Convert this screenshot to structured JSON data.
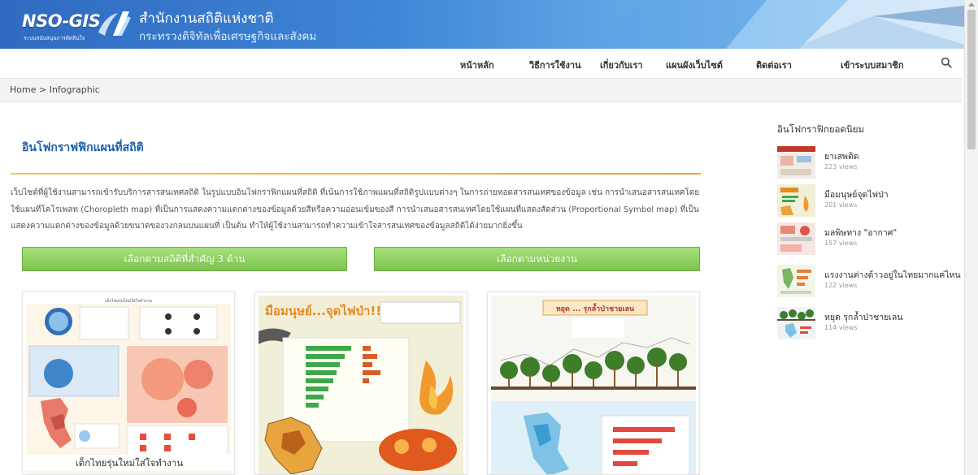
{
  "header": {
    "logo_text": "NSO-GIS",
    "logo_subtext": "ระบบสนับสนุนการตัดสินใจ",
    "site_name": "สำนักงานสถิติแห่งชาติ",
    "site_subtitle": "กระทรวงดิจิทัลเพื่อเศรษฐกิจและสังคม"
  },
  "nav": {
    "items": [
      {
        "label": "หน้าหลัก"
      },
      {
        "label": "วิธีการใช้งาน"
      },
      {
        "label": "เกี่ยวกับเรา"
      },
      {
        "label": "แผนผังเว็บไซต์"
      },
      {
        "label": "ติดต่อเรา"
      },
      {
        "label": "เข้าระบบสมาชิก"
      }
    ],
    "search_icon": "search-icon"
  },
  "breadcrumb": {
    "home": "Home",
    "separator": ">",
    "current": "Infographic"
  },
  "main": {
    "title": "อินโฟกราฟฟิกแผนที่สถิติ",
    "description": "เว็บไซต์ที่ผู้ใช้งานสามารถเข้ารับบริการสารสนเทศสถิติ ในรูปแบบอินโฟกราฟิกแผนที่สถิติ ที่เน้นการใช้ภาพแผนที่สถิติรูปแบบต่างๆ ในการถ่ายทอดสารสนเทศของข้อมูล เช่น การนำเสนอสารสนเทศโดยใช้แผนที่โคโรเพลท (Choropleth map) ที่เป็นการแสดงความแตกต่างของข้อมูลด้วยสีหรือความอ่อนเข้มของสี การนำเสนอสารสนเทศโดยใช้แผนที่แสดงสัดส่วน (Proportional Symbol map) ที่เป็นแสดงความแตกต่างของข้อมูลด้วยขนาดของวงกลมบนแผนที่ เป็นต้น ทำให้ผู้ใช้งานสามารถทำความเข้าใจสารสนเทศของข้อมูลสถิติได้ง่ายมากยิ่งขึ้น",
    "buttons": [
      {
        "label": "เลือกตามสถิติที่สำคัญ 3 ด้าน"
      },
      {
        "label": "เลือกตามหน่วยงาน"
      }
    ],
    "cards": [
      {
        "caption": "เด็กไทยรุ่นใหม่ใส่ใจทำงาน",
        "heading": "เด็กไทยรุ่นใหม่ใส่ใจทำงาน"
      },
      {
        "caption": "",
        "heading": "มือมนุษย์...จุดไฟป่า!!!"
      },
      {
        "caption": "",
        "heading": "หยุด ... รุกล้ำป่าชายเลน"
      }
    ]
  },
  "sidebar": {
    "title": "อินโฟกราฟิกยอดนิยม",
    "items": [
      {
        "title": "ยาเสพติด",
        "views": "223 views"
      },
      {
        "title": "มือมนุษย์จุดไฟป่า",
        "views": "201 views"
      },
      {
        "title": "มลพิษทาง \"อากาศ\"",
        "views": "157 views"
      },
      {
        "title": "แรงงานต่างด้าวอยู่ในไทยมากแค่ไหน",
        "views": "122 views"
      },
      {
        "title": "หยุด รุกล้ำป่าชายเลน",
        "views": "114 views"
      }
    ]
  },
  "colors": {
    "accent_blue": "#1d5faa",
    "button_green": "#8ed062",
    "rule_orange": "#f0b44e"
  }
}
